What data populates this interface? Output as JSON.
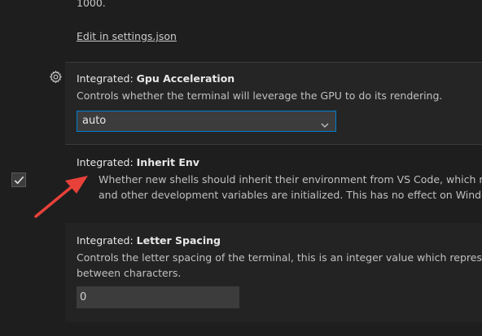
{
  "prev_setting": {
    "desc_line1": "",
    "desc_line2": "1000.",
    "edit_link": "Edit in settings.json"
  },
  "gpu": {
    "category": "Integrated: ",
    "name": "Gpu Acceleration",
    "description": "Controls whether the terminal will leverage the GPU to do its rendering.",
    "selected_value": "auto"
  },
  "inherit_env": {
    "category": "Integrated: ",
    "name": "Inherit Env",
    "checked": true,
    "description_line1": "Whether new shells should inherit their environment from VS Code, which may sou",
    "description_line2": "and other development variables are initialized. This has no effect on Windows."
  },
  "letter_spacing": {
    "category": "Integrated: ",
    "name": "Letter Spacing",
    "description_line1": "Controls the letter spacing of the terminal, this is an integer value which represents the",
    "description_line2": "between characters.",
    "value": "0"
  },
  "colors": {
    "background": "#1e1e1e",
    "focused_background": "#252526",
    "select_border": "#007fd4",
    "annotation_arrow": "#e8413a"
  }
}
